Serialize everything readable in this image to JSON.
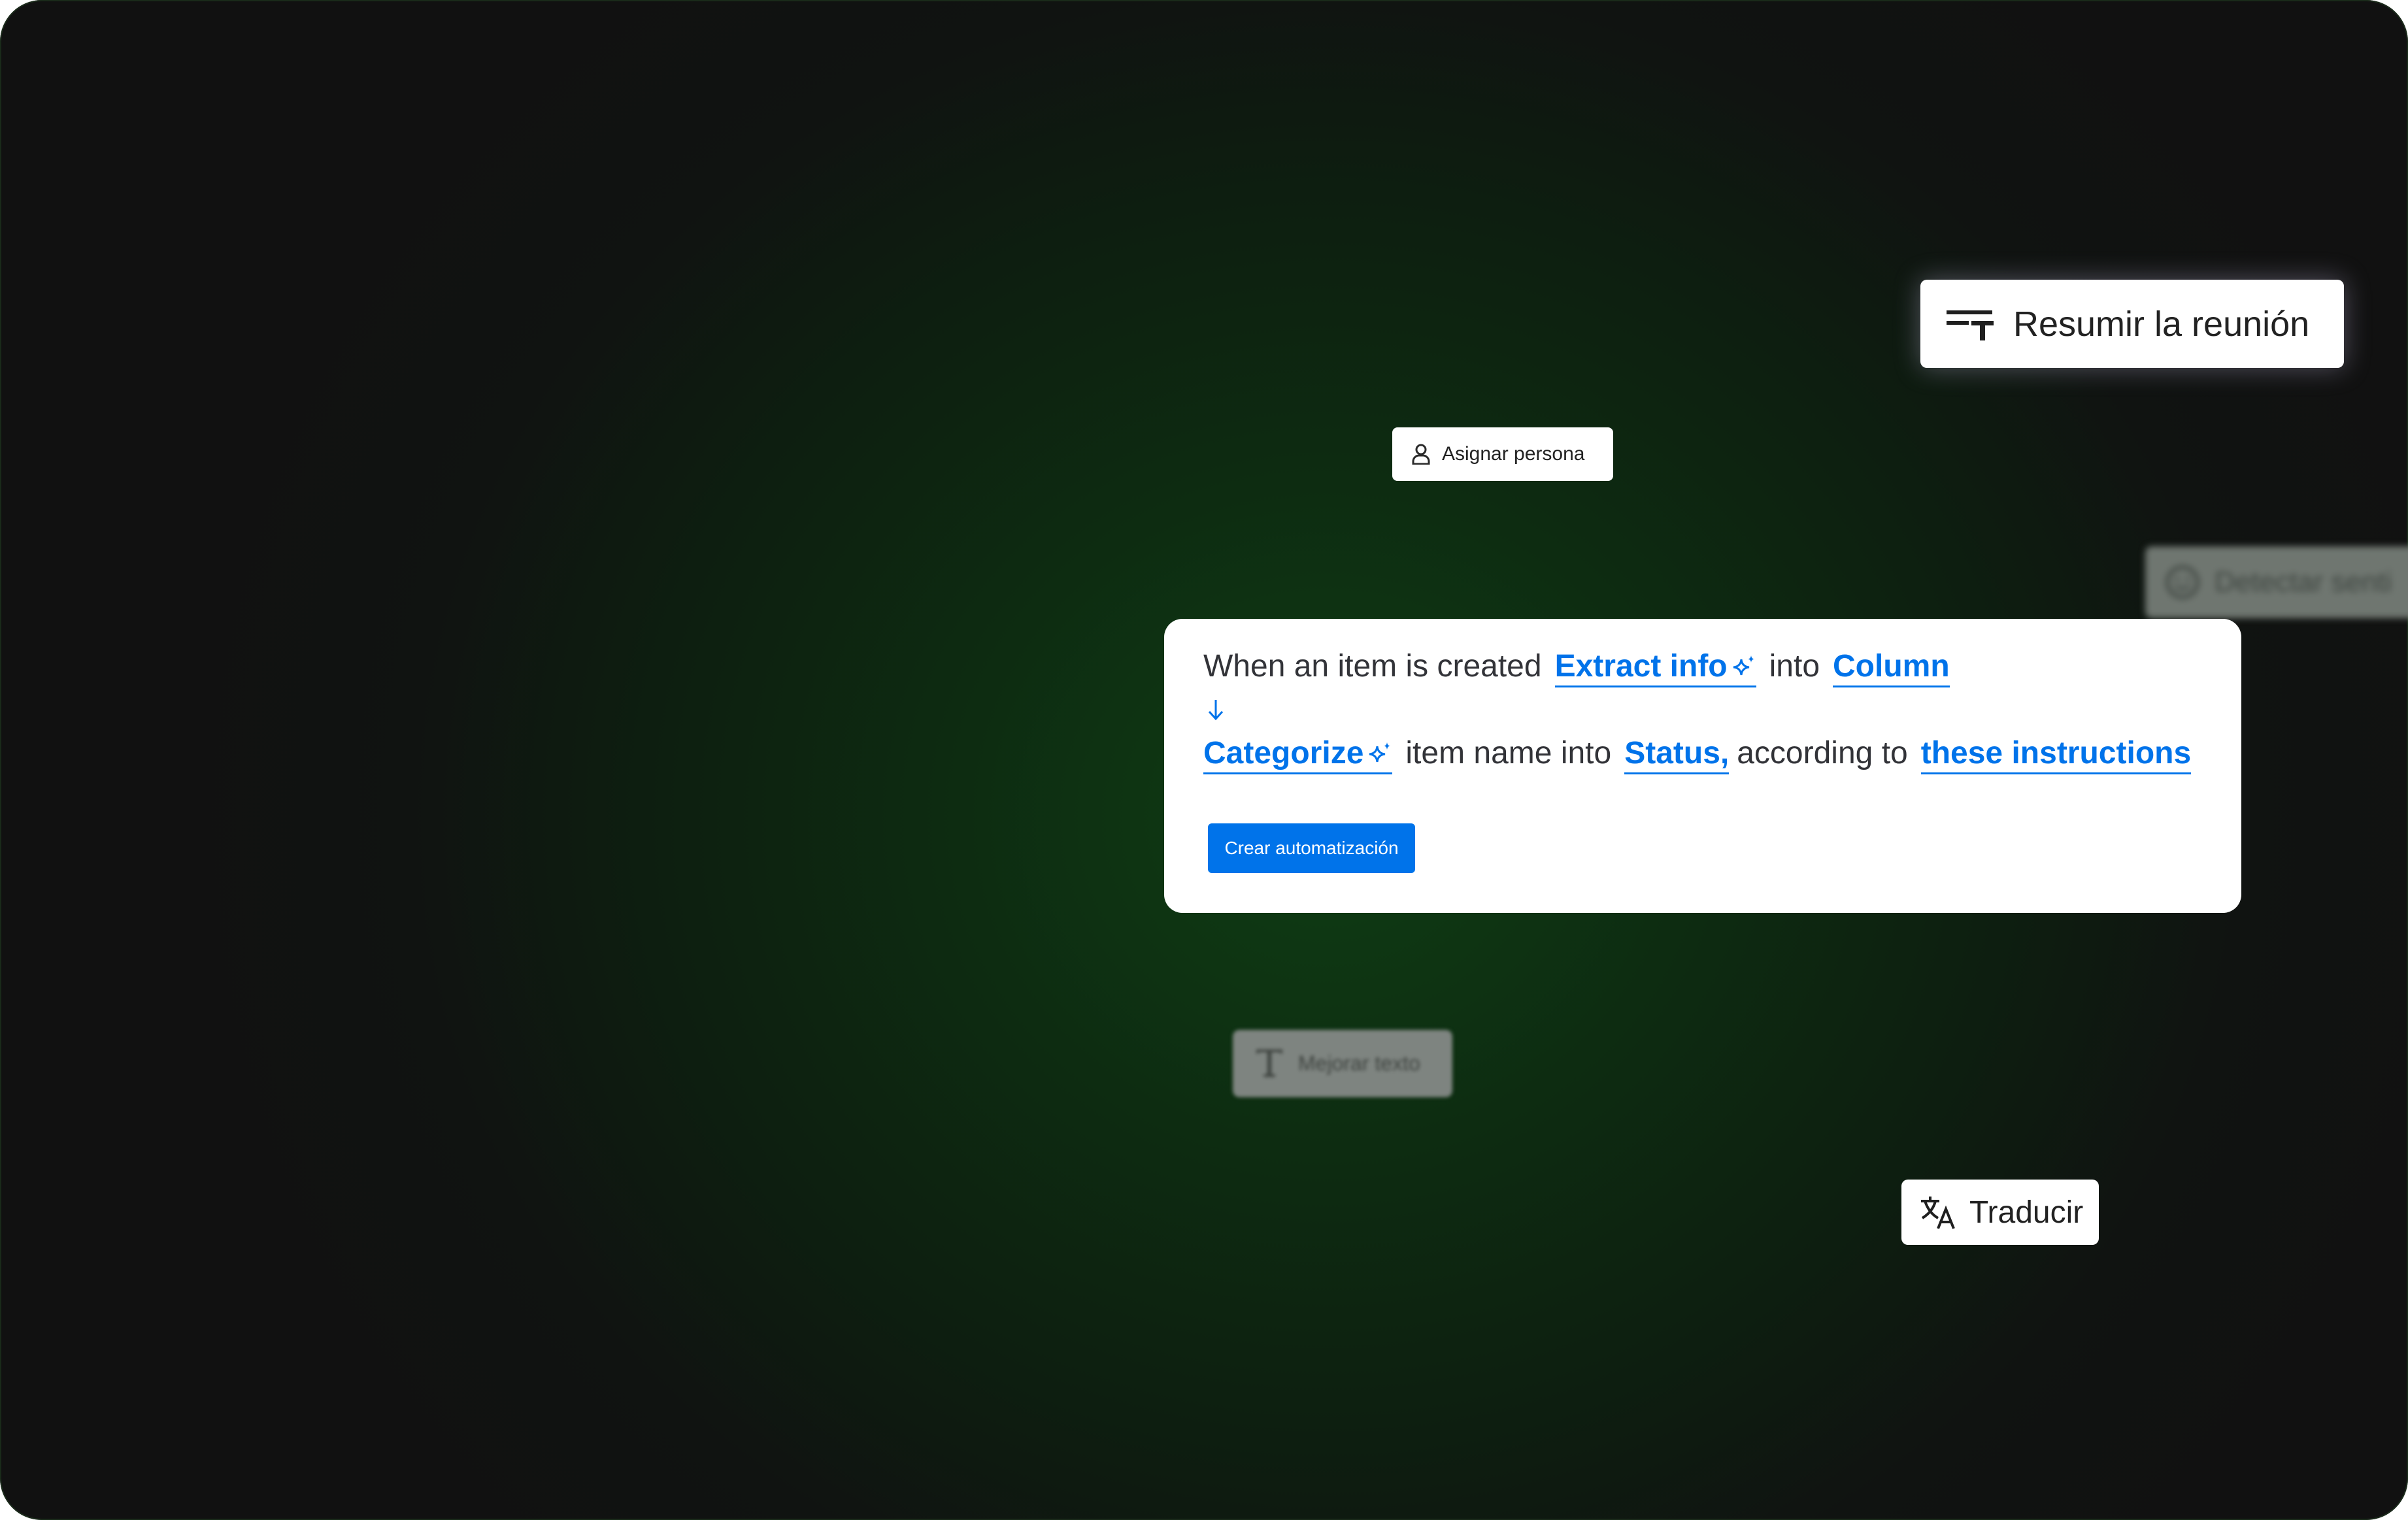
{
  "chips": {
    "resumir": {
      "label": "Resumir la reunión",
      "icon": "summarize-text-icon"
    },
    "asignar": {
      "label": "Asignar persona",
      "icon": "person-icon"
    },
    "detectar": {
      "label": "Detectar senti",
      "icon": "smiley-face-icon"
    },
    "mejorar": {
      "label": "Mejorar texto",
      "icon": "text-format-icon"
    },
    "traducir": {
      "label": "Traducir",
      "icon": "translate-icon"
    }
  },
  "automation": {
    "line1": {
      "trigger": "When an item is created",
      "action": "Extract info",
      "connector": "into",
      "target": "Column"
    },
    "line2": {
      "action": "Categorize",
      "subject": "item name into",
      "target": "Status,",
      "connector": "according to",
      "instructions": "these instructions"
    },
    "button_label": "Crear automatización"
  },
  "colors": {
    "accent": "#0073ea",
    "background_glow": "#0f3d14",
    "background_dark": "#111111",
    "card": "#ffffff"
  }
}
